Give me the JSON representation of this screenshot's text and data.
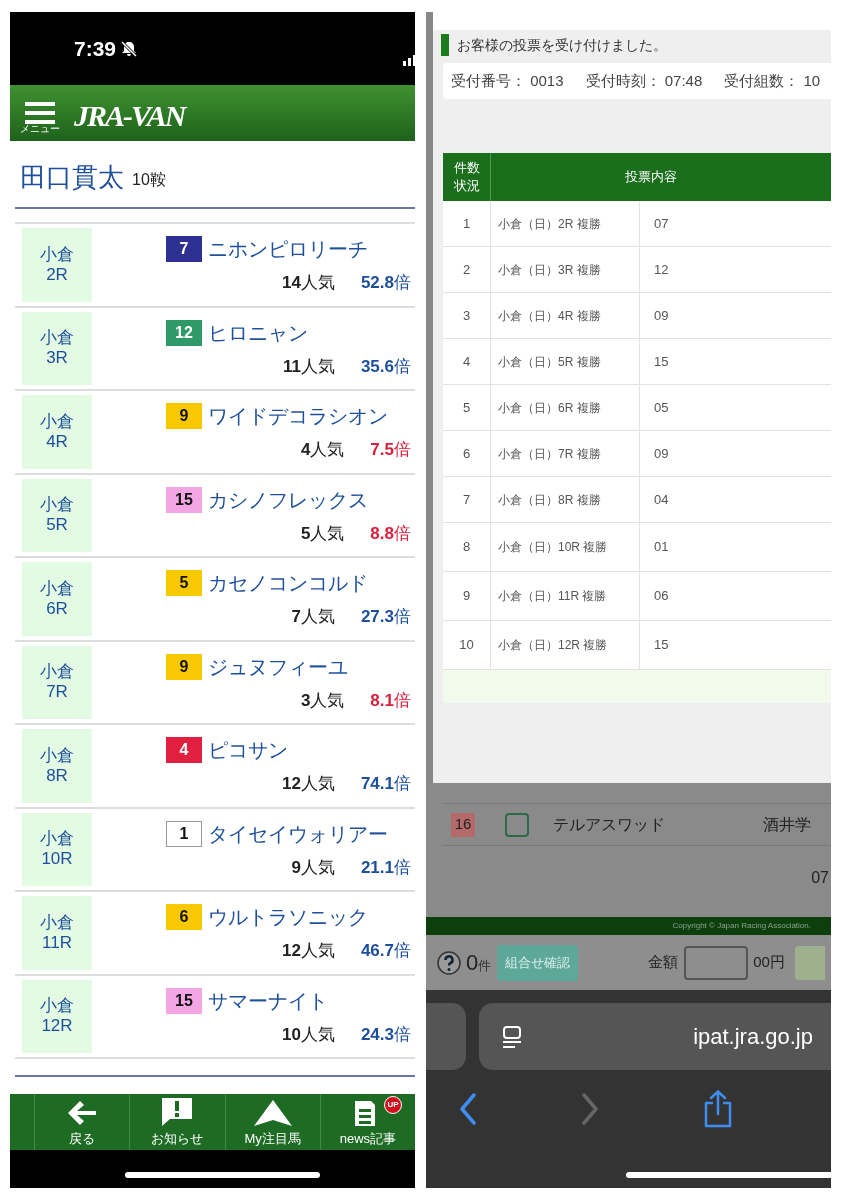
{
  "left": {
    "status_bar": {
      "time": "7:39"
    },
    "header": {
      "menu_label": "メニュー",
      "logo": "JRA-VAN"
    },
    "jockey": {
      "name": "田口貫太",
      "count": "10鞍"
    },
    "rides": [
      {
        "venue": "小倉",
        "race": "2R",
        "number": "7",
        "color": "#2e3192",
        "horse": "ニホンピロリーチ",
        "popularity": "**14**人気",
        "odds": "**52.8**倍",
        "favored": false
      },
      {
        "venue": "小倉",
        "race": "3R",
        "number": "12",
        "color": "#2f9a68",
        "horse": "ヒロニャン",
        "popularity": "**11**人気",
        "odds": "**35.6**倍",
        "favored": false
      },
      {
        "venue": "小倉",
        "race": "4R",
        "number": "9",
        "color": "#f8c800",
        "horse": "ワイドデコラシオン",
        "popularity": "**4**人気",
        "odds": "**7.5**倍",
        "favored": true
      },
      {
        "venue": "小倉",
        "race": "5R",
        "number": "15",
        "color": "#f4a6e4",
        "horse": "カシノフレックス",
        "popularity": "**5**人気",
        "odds": "**8.8**倍",
        "favored": true
      },
      {
        "venue": "小倉",
        "race": "6R",
        "number": "5",
        "color": "#f8c800",
        "horse": "カセノコンコルド",
        "popularity": "**7**人気",
        "odds": "**27.3**倍",
        "favored": false
      },
      {
        "venue": "小倉",
        "race": "7R",
        "number": "9",
        "color": "#f8c800",
        "horse": "ジュヌフィーユ",
        "popularity": "**3**人気",
        "odds": "**8.1**倍",
        "favored": true
      },
      {
        "venue": "小倉",
        "race": "8R",
        "number": "4",
        "color": "#e0203e",
        "horse": "ピコサン",
        "popularity": "**12**人気",
        "odds": "**74.1**倍",
        "favored": false
      },
      {
        "venue": "小倉",
        "race": "10R",
        "number": "1",
        "color": "#ffffff",
        "horse": "タイセイウォリアー",
        "popularity": "**9**人気",
        "odds": "**21.1**倍",
        "favored": false
      },
      {
        "venue": "小倉",
        "race": "11R",
        "number": "6",
        "color": "#f8c800",
        "horse": "ウルトラソニック",
        "popularity": "**12**人気",
        "odds": "**46.7**倍",
        "favored": false
      },
      {
        "venue": "小倉",
        "race": "12R",
        "number": "15",
        "color": "#f4a6e4",
        "horse": "サマーナイト",
        "popularity": "**10**人気",
        "odds": "**24.3**倍",
        "favored": false
      }
    ],
    "bottom_nav": [
      {
        "label": "戻る",
        "kind": "back"
      },
      {
        "label": "お知らせ",
        "kind": "notice"
      },
      {
        "label": "My注目馬",
        "kind": "favorite"
      },
      {
        "label": "news記事",
        "kind": "news",
        "badge": "UP"
      }
    ]
  },
  "right": {
    "message": "お客様の投票を受け付けました。",
    "receipt": [
      {
        "label": "受付番号：",
        "value": "0013"
      },
      {
        "label": "受付時刻：",
        "value": "07:48"
      },
      {
        "label": "受付組数：",
        "value": "10"
      }
    ],
    "table": {
      "columns": [
        "件数状況",
        "投票内容"
      ],
      "rows": [
        {
          "no": "1",
          "content": "小倉（日）2R 複勝",
          "selection": "07"
        },
        {
          "no": "2",
          "content": "小倉（日）3R 複勝",
          "selection": "12"
        },
        {
          "no": "3",
          "content": "小倉（日）4R 複勝",
          "selection": "09"
        },
        {
          "no": "4",
          "content": "小倉（日）5R 複勝",
          "selection": "15"
        },
        {
          "no": "5",
          "content": "小倉（日）6R 複勝",
          "selection": "05"
        },
        {
          "no": "6",
          "content": "小倉（日）7R 複勝",
          "selection": "09"
        },
        {
          "no": "7",
          "content": "小倉（日）8R 複勝",
          "selection": "04"
        },
        {
          "no": "8",
          "content": "小倉（日）10R 複勝",
          "selection": "01"
        },
        {
          "no": "9",
          "content": "小倉（日）11R 複勝",
          "selection": "06"
        },
        {
          "no": "10",
          "content": "小倉（日）12R 複勝",
          "selection": "15"
        }
      ]
    },
    "background_rows": [
      {
        "number": "16",
        "horse": "テルアスワッド",
        "jockey": "酒井学",
        "checked": false
      }
    ],
    "time_fragment": "07",
    "copyright": "Copyright © Japan Racing Association.",
    "bet_bar": {
      "count": "0",
      "unit": "件",
      "confirm_button": "組合せ確認",
      "amount_label": "金額",
      "amount_unit": "00円"
    },
    "browser": {
      "url": "ipat.jra.go.jp"
    }
  }
}
